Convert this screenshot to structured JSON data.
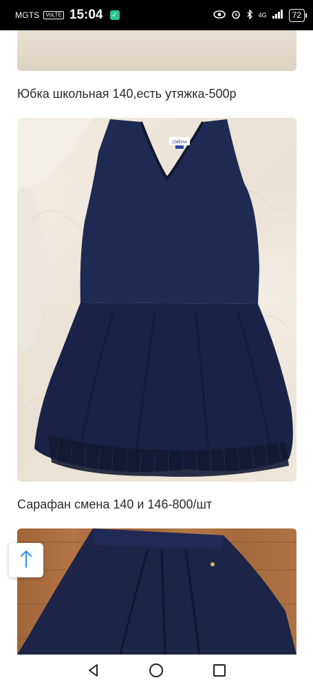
{
  "status_bar": {
    "carrier": "MGTS",
    "volte": "VoLTE",
    "time": "15:04",
    "network": "4G",
    "battery": "72"
  },
  "listing": {
    "captions": [
      "Юбка школьная 140,есть утяжка-500р",
      "Сарафан смена 140 и 146-800/шт"
    ],
    "dress_label": "СМЕНА"
  },
  "icons": {
    "scroll_top": "arrow-up-icon",
    "nav_back": "triangle-back-icon",
    "nav_home": "circle-home-icon",
    "nav_recents": "square-recents-icon"
  },
  "colors": {
    "navy": "#1c2448",
    "accent": "#2f8ef0"
  }
}
